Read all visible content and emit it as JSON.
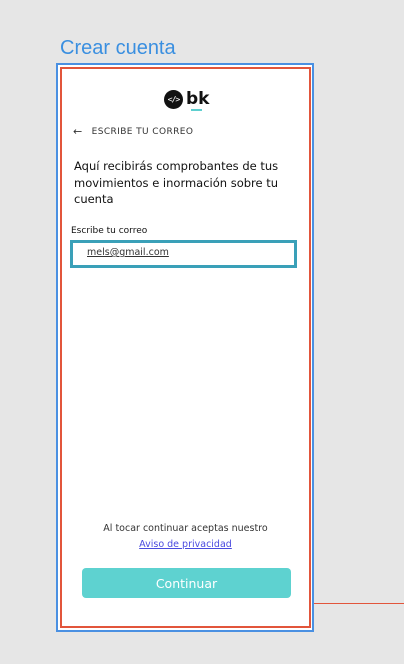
{
  "frame": {
    "title": "Crear cuenta"
  },
  "logo": {
    "icon_glyph": "</>",
    "icon_name": "code-icon",
    "text": "bk",
    "accent_color": "#5ecfcf"
  },
  "header": {
    "back_icon": "arrow-left-icon",
    "back_glyph": "←",
    "step_title": "ESCRIBE TU CORREO"
  },
  "main": {
    "description": "Aquí recibirás comprobantes de tus movimientos e inormación sobre tu cuenta",
    "email_label": "Escribe tu correo",
    "email_value": "mels@gmail.com"
  },
  "footer": {
    "terms_text": "Al tocar continuar aceptas nuestro",
    "privacy_link": "Aviso de privacidad",
    "continue_label": "Continuar",
    "continue_color": "#5ed2d0"
  },
  "colors": {
    "selection_blue": "#4a90e2",
    "frame_red": "#e2553b",
    "field_highlight": "#3aa0b8",
    "link_color": "#4a4adf"
  }
}
